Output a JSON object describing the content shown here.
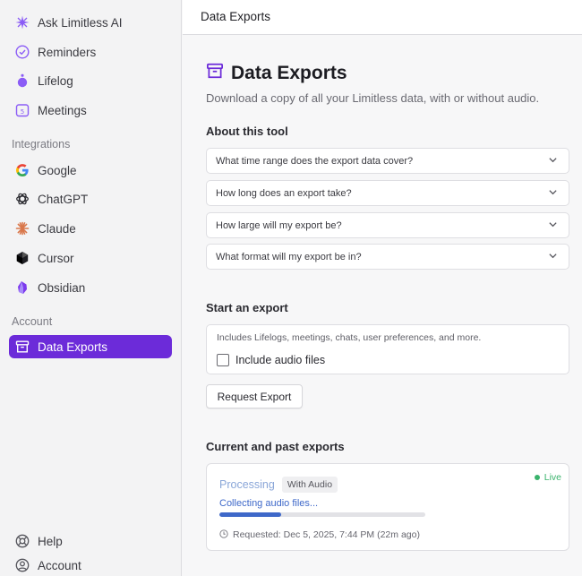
{
  "sidebar": {
    "top_items": [
      {
        "label": "Ask Limitless AI",
        "icon": "sparkle-icon"
      },
      {
        "label": "Reminders",
        "icon": "check-circle-icon"
      },
      {
        "label": "Lifelog",
        "icon": "pendant-icon"
      },
      {
        "label": "Meetings",
        "icon": "calendar-icon"
      }
    ],
    "integrations_label": "Integrations",
    "integrations": [
      {
        "label": "Google",
        "icon": "google-icon"
      },
      {
        "label": "ChatGPT",
        "icon": "openai-icon"
      },
      {
        "label": "Claude",
        "icon": "claude-icon"
      },
      {
        "label": "Cursor",
        "icon": "cursor-icon"
      },
      {
        "label": "Obsidian",
        "icon": "obsidian-icon"
      }
    ],
    "account_label": "Account",
    "active_item": {
      "label": "Data Exports",
      "icon": "archive-icon"
    },
    "bottom_items": [
      {
        "label": "Help",
        "icon": "lifebuoy-icon"
      },
      {
        "label": "Account",
        "icon": "user-circle-icon"
      }
    ]
  },
  "header": {
    "title": "Data Exports"
  },
  "main": {
    "title": "Data Exports",
    "subtitle": "Download a copy of all your Limitless data, with or without audio.",
    "about_heading": "About this tool",
    "faqs": [
      "What time range does the export data cover?",
      "How long does an export take?",
      "How large will my export be?",
      "What format will my export be in?"
    ],
    "start_heading": "Start an export",
    "export_description": "Includes Lifelogs, meetings, chats, user preferences, and more.",
    "include_audio_label": "Include audio files",
    "include_audio_checked": false,
    "request_button": "Request Export",
    "exports_heading": "Current and past exports",
    "export_item": {
      "status": "Processing",
      "badge": "With Audio",
      "live_label": "Live",
      "progress_label": "Collecting audio files...",
      "progress_fraction": 0.3,
      "requested": "Requested: Dec 5, 2025, 7:44 PM (22m ago)"
    }
  },
  "colors": {
    "accent": "#6c2bd9",
    "live": "#3ab36c",
    "progress": "#3e68c9"
  }
}
